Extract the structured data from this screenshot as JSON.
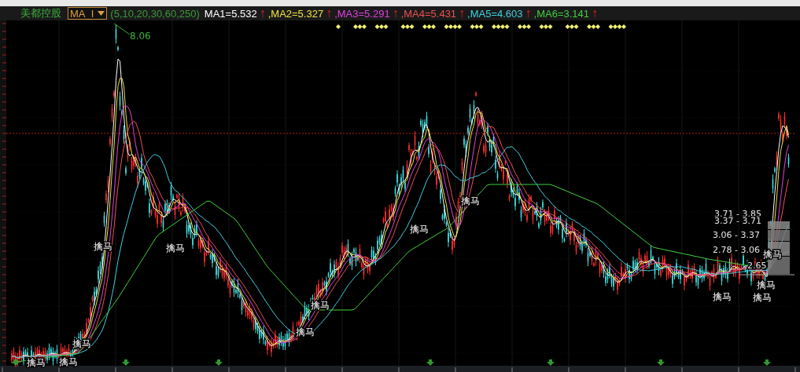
{
  "stock": {
    "name": "美都控股"
  },
  "indicator": {
    "name": "MA_I",
    "params": "(5,10,20,30,60,250)",
    "values": [
      {
        "label": "MA1=5.532",
        "color": "#ffffff",
        "arrow": "↑"
      },
      {
        "label": ",MA2=5.327",
        "color": "#f0e040",
        "arrow": "↑"
      },
      {
        "label": ",MA3=5.291",
        "color": "#e040e0",
        "arrow": "↑"
      },
      {
        "label": ",MA4=5.431",
        "color": "#f05050",
        "arrow": "↑"
      },
      {
        "label": ",MA5=4.603",
        "color": "#40d0e0",
        "arrow": "↑"
      },
      {
        "label": ",MA6=3.141",
        "color": "#40d040",
        "arrow": "↑"
      }
    ]
  },
  "chart": {
    "peak_label": "8.06",
    "signal_labels": [
      "擒马",
      "擒马",
      "擒马",
      "擒马",
      "擒马",
      "擒马",
      "擒马",
      "擒马",
      "擒马",
      "擒马",
      "擒马",
      "擒马",
      "擒马"
    ],
    "range_labels": [
      "3.71 - 3.85",
      "3.37 - 3.71",
      "3.06 - 3.37",
      "2.78 - 3.06",
      "2.65"
    ]
  }
}
